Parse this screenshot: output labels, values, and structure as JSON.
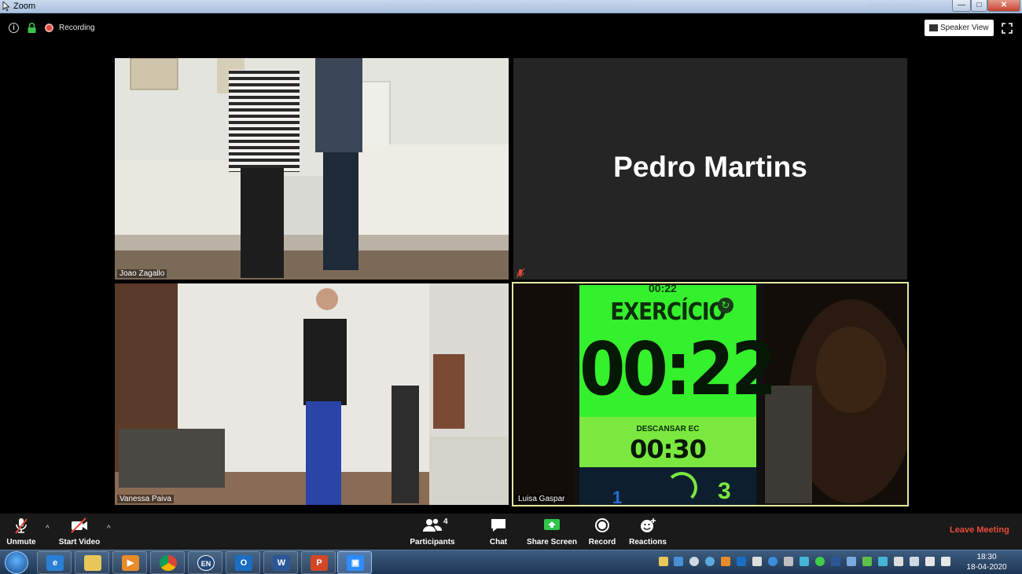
{
  "window": {
    "title": "Zoom",
    "faded_title": "Physical activity: intervention (see specific steps for Exercise in Group)",
    "faded_user": "Pedro Martins",
    "minimize": "—",
    "maximize": "□",
    "close": "✕"
  },
  "topbar": {
    "recording_label": "Recording",
    "speaker_view_label": "Speaker View",
    "icons": [
      "info-icon",
      "lock-icon",
      "recording-icon",
      "fullscreen-icon"
    ]
  },
  "tiles": {
    "joao": {
      "name": "Joao Zagallo"
    },
    "pedro": {
      "display_name": "Pedro Martins"
    },
    "vanessa": {
      "name": "Vanessa Paiva"
    },
    "luisa": {
      "name": "Luisa Gaspar",
      "timer": {
        "top_partial": "00:22",
        "label": "EXERCÍCIO",
        "time": "00:22",
        "rest_label": "DESCANSAR EC",
        "rest_time": "00:30",
        "round_left": "1",
        "round_right": "3"
      }
    }
  },
  "toolbar": {
    "unmute": "Unmute",
    "start_video": "Start Video",
    "participants": "Participants",
    "participants_count": "4",
    "chat": "Chat",
    "share_screen": "Share Screen",
    "record": "Record",
    "reactions": "Reactions",
    "leave": "Leave Meeting",
    "caret": "^"
  },
  "taskbar": {
    "apps": [
      "internet-explorer",
      "file-explorer",
      "media-player",
      "chrome",
      "language-en",
      "outlook",
      "word",
      "powerpoint",
      "zoom"
    ],
    "lang": "EN",
    "time": "18:30",
    "date": "18-04-2020"
  },
  "colors": {
    "timer_green": "#35f02c",
    "active_speaker_border": "#e4e9a0",
    "leave_red": "#e74c3c",
    "share_green": "#2fc54d"
  }
}
